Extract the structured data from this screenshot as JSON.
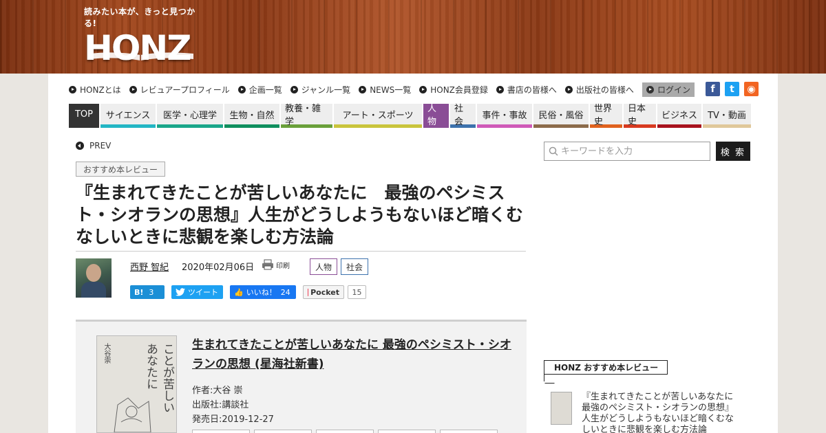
{
  "header": {
    "tagline": "読みたい本が、きっと見つかる!",
    "logo_text": "HONZ"
  },
  "topnav": {
    "items": [
      "HONZとは",
      "レビュアープロフィール",
      "企画一覧",
      "ジャンル一覧",
      "NEWS一覧",
      "HONZ会員登録",
      "書店の皆様へ",
      "出版社の皆様へ"
    ],
    "login": "ログイン"
  },
  "social_top": [
    {
      "icon": "facebook-icon",
      "glyph": "f",
      "color": "#3b5998"
    },
    {
      "icon": "twitter-icon",
      "glyph": "t",
      "color": "#1da1f2"
    },
    {
      "icon": "rss-icon",
      "glyph": "◉",
      "color": "#f26522"
    }
  ],
  "categories": [
    {
      "label": "TOP",
      "color": "#333333",
      "active": true,
      "width": 44
    },
    {
      "label": "サイエンス",
      "color": "#23b6c4",
      "width": 80
    },
    {
      "label": "医学・心理学",
      "color": "#1aa68a",
      "width": 96
    },
    {
      "label": "生物・自然",
      "color": "#0f8f5e",
      "width": 80
    },
    {
      "label": "教養・雑学",
      "color": "#6aa03a",
      "width": 75
    },
    {
      "label": "アート・スポーツ",
      "color": "#c9c43c",
      "width": 128
    },
    {
      "label": "人物",
      "color": "#8a4d96",
      "active": true,
      "width": 37
    },
    {
      "label": "社会",
      "color": "#3d72ad",
      "width": 37
    },
    {
      "label": "事件・事故",
      "color": "#cf5ab8",
      "width": 80
    },
    {
      "label": "民俗・風俗",
      "color": "#8c6b4a",
      "width": 80
    },
    {
      "label": "世界史",
      "color": "#e0621e",
      "width": 47
    },
    {
      "label": "日本史",
      "color": "#d83a20",
      "width": 47
    },
    {
      "label": "ビジネス",
      "color": "#a8121d",
      "width": 64
    },
    {
      "label": "TV・動画",
      "color": "#e0c89a",
      "width": 70
    }
  ],
  "prev_label": "PREV",
  "badge": "おすすめ本レビュー",
  "article": {
    "title": "『生まれてきたことが苦しいあなたに　最強のペシミスト・シオランの思想』人生がどうしようもないほど暗くむなしいときに悲観を楽しむ方法論",
    "author": "西野 智紀",
    "date": "2020年02月06日",
    "print": "印刷",
    "tags": [
      "人物",
      "社会"
    ]
  },
  "share": {
    "hatena": "B!",
    "hatena_count": "3",
    "tweet": "ツイート",
    "like": "いいね！",
    "like_count": "24",
    "pocket": "Pocket",
    "pocket_count": "15"
  },
  "book": {
    "title": "生まれてきたことが苦しいあなたに 最強のペシミスト・シオランの思想 (星海社新書)",
    "author": "作者:大谷 崇",
    "publisher": "出版社:講談社",
    "release": "発売日:2019-12-27",
    "cover_title": "生まれてきたことが苦しいあなたに",
    "cover_author": "大谷崇"
  },
  "search": {
    "placeholder": "キーワードを入力",
    "button": "検 索"
  },
  "recommend": {
    "heading": "HONZ おすすめ本レビュー",
    "item": "『生まれてきたことが苦しいあなたに　最強のペシミスト・シオランの思想』人生がどうしようもないほど暗くむなしいときに悲観を楽しむ方法論"
  }
}
